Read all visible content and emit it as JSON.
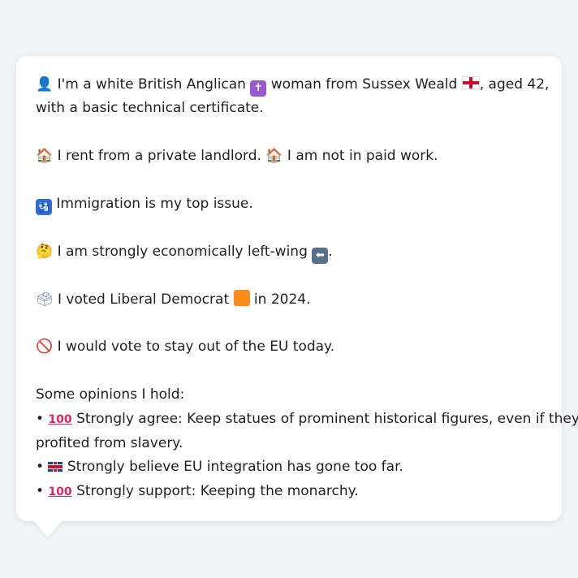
{
  "profile": {
    "line1_a": "I'm a white British Anglican",
    "line1_b": "woman from Sussex Weald",
    "line1_c": ", aged 42,",
    "line1_d": "with a basic technical certificate.",
    "line2_a": "I rent from a private landlord.",
    "line2_b": "I am not in paid work.",
    "line3": "Immigration is my top issue.",
    "line4_a": "I am strongly economically left-wing",
    "line4_b": ".",
    "line5_a": "I voted Liberal Democrat",
    "line5_b": "in 2024.",
    "line6": "I would vote to stay out of the EU today."
  },
  "opinions": {
    "heading": "Some opinions I hold:",
    "bullet": "•",
    "items": [
      {
        "text": "Strongly agree: Keep statues of prominent historical figures, even if they",
        "cont": "profited from slavery."
      },
      {
        "text": "Strongly believe EU integration has gone too far."
      },
      {
        "text": "Strongly support: Keeping the monarchy."
      }
    ]
  },
  "icons": {
    "person": "person-icon",
    "cross": "latin-cross-icon",
    "flag_england": "england-flag-icon",
    "house": "house-icon",
    "immigration": "passport-control-icon",
    "thinking": "thinking-face-icon",
    "left_arrow": "left-arrow-icon",
    "ballot": "ballot-box-icon",
    "orange_square": "orange-square-icon",
    "no_entry": "no-entry-icon",
    "hundred": "hundred-points-icon",
    "flag_uk": "uk-flag-icon"
  },
  "colors": {
    "background": "#f2f3f5",
    "bubble": "#ffffff",
    "text": "#1f1f1f"
  }
}
